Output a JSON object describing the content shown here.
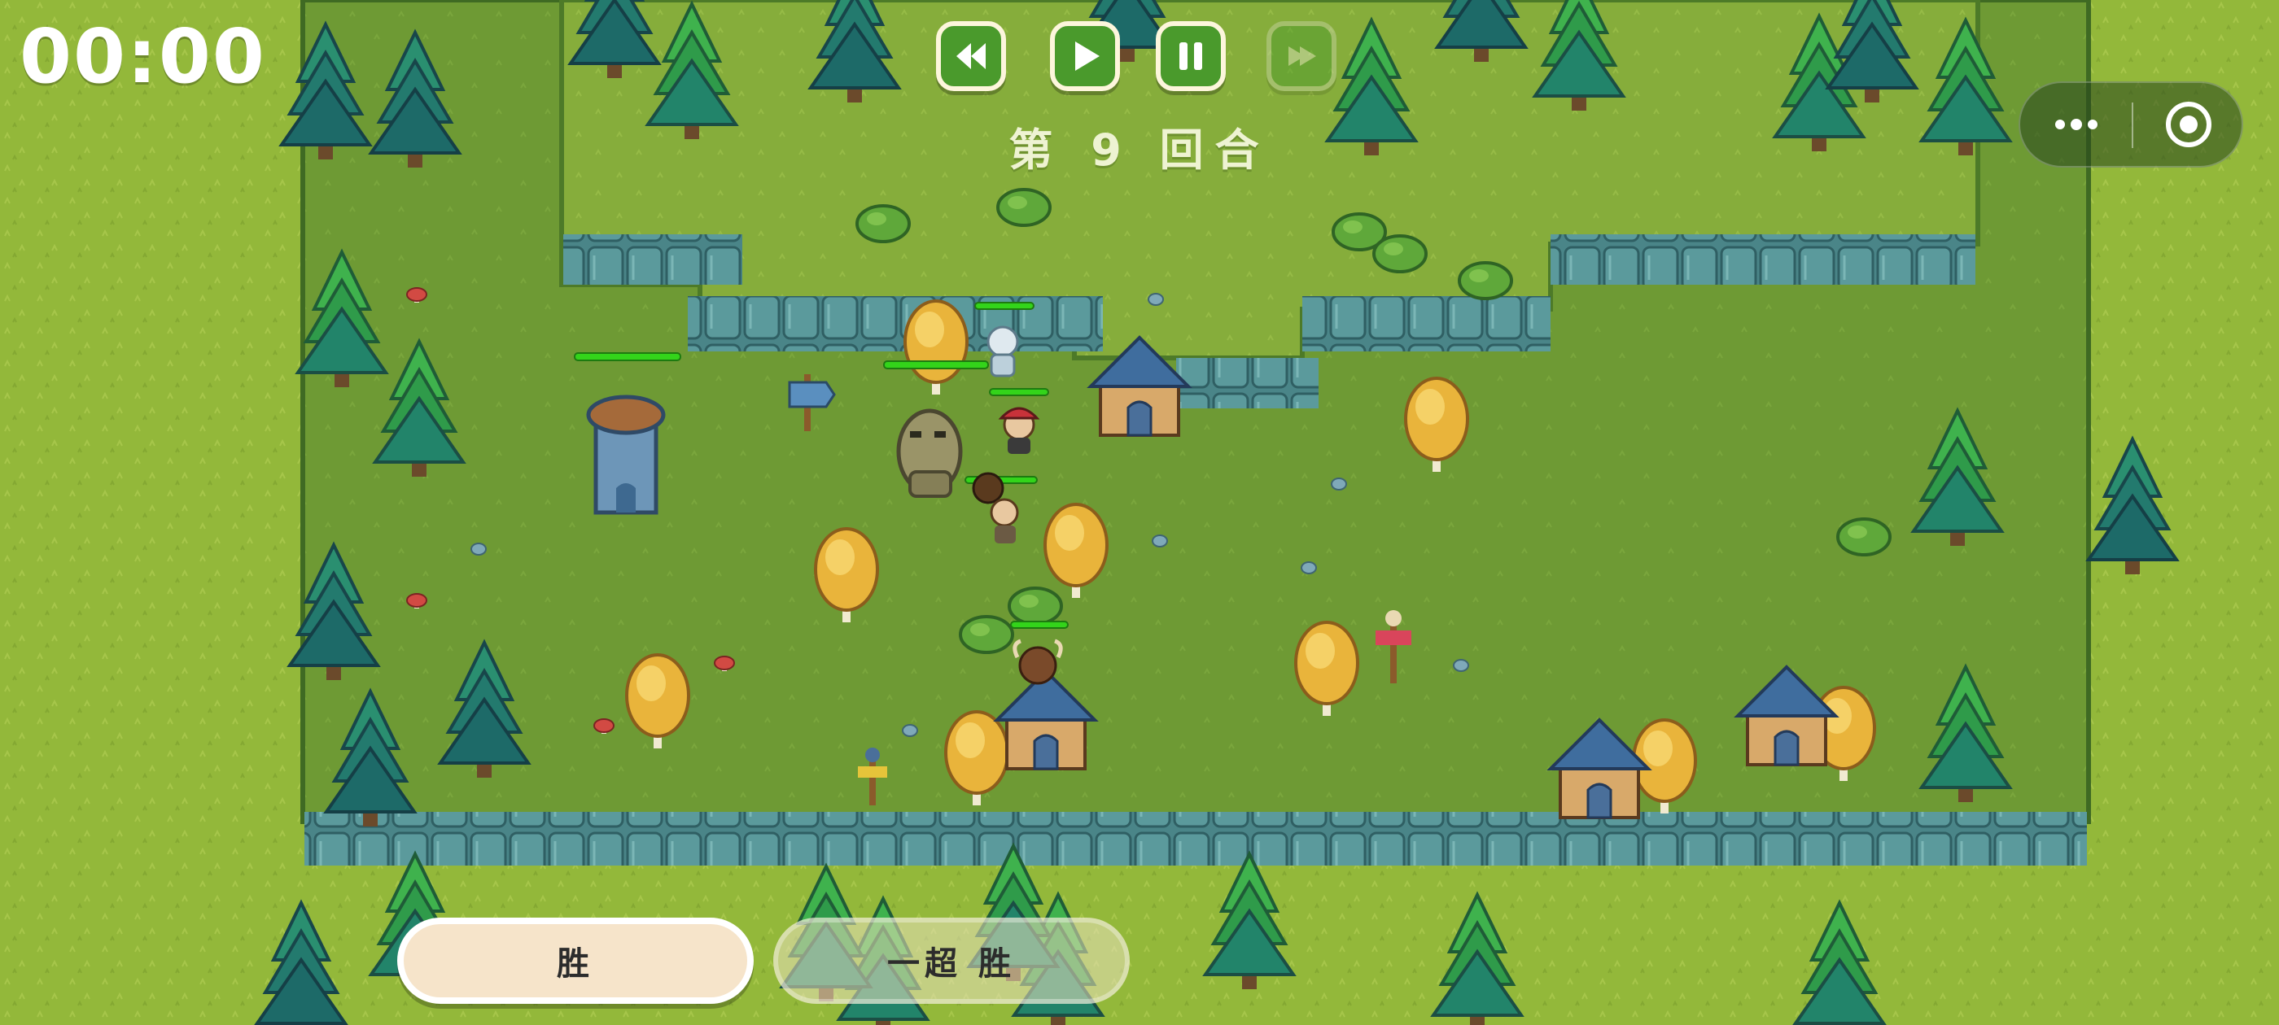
{
  "hud": {
    "timer": "00:00",
    "round_text": "第 9 回合"
  },
  "controls": [
    {
      "name": "rewind-button",
      "icon": "rewind-icon",
      "enabled": true
    },
    {
      "name": "play-button",
      "icon": "play-icon",
      "enabled": true
    },
    {
      "name": "pause-button",
      "icon": "pause-icon",
      "enabled": true
    },
    {
      "name": "skip-button",
      "icon": "skip-icon",
      "enabled": false
    }
  ],
  "capsule": {
    "more_icon": "more-dots-icon",
    "close_icon": "target-circle-icon"
  },
  "bottom_buttons": {
    "win_label": "胜",
    "super_win_label": "一超 胜"
  },
  "units": [
    {
      "name": "skeleton-mage",
      "icon": "skeleton-icon",
      "health": 1.0
    },
    {
      "name": "stone-golem",
      "icon": "golem-icon",
      "health": 1.0
    },
    {
      "name": "pirate-warrior",
      "icon": "pirate-icon",
      "health": 1.0
    },
    {
      "name": "dreadlock-warrior",
      "icon": "warrior-icon",
      "health": 1.0
    },
    {
      "name": "minotaur",
      "icon": "minotaur-icon",
      "health": 1.0
    },
    {
      "name": "stone-tower",
      "icon": "tower-icon",
      "health": 1.0
    }
  ],
  "colors": {
    "grass_outer": "#93b83a",
    "grass_field": "#6e9a34",
    "grass_upper": "#86ad3b",
    "cliff": "#4a8588",
    "button_green": "#4a9a2c",
    "button_border": "#fdf6dc",
    "health_bar": "#33d41a",
    "win_button": "#f6e4ca"
  }
}
